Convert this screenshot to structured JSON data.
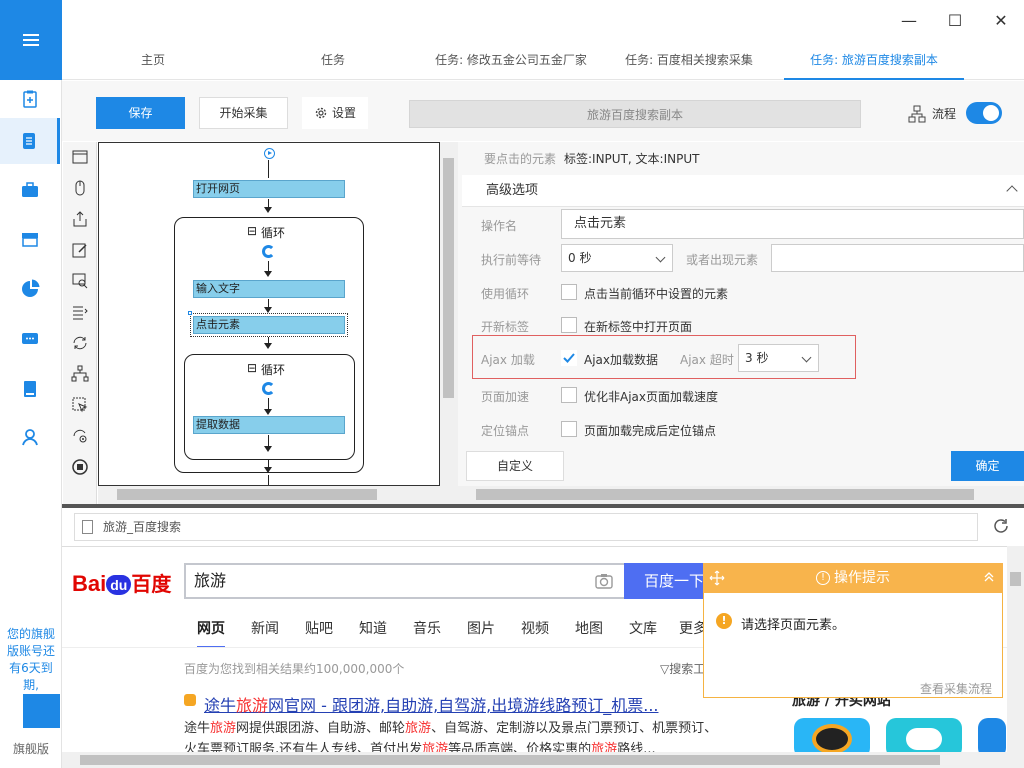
{
  "window": {
    "minimize": "—",
    "maximize": "☐",
    "close": "✕"
  },
  "tabs": [
    "主页",
    "任务",
    "任务: 修改五金公司五金厂家",
    "任务: 百度相关搜索采集",
    "任务: 旅游百度搜索副本"
  ],
  "toolbar": {
    "save": "保存",
    "start": "开始采集",
    "settings": "设置",
    "task_name": "旅游百度搜索副本",
    "flow": "流程",
    "flow_toggle": true
  },
  "sidebar": {
    "trial_notice": "您的旗舰版账号还有6天到期,",
    "edition": "旗舰版"
  },
  "workflow": {
    "open_page": "打开网页",
    "loop1": "循环",
    "input_text": "输入文字",
    "click_element": "点击元素",
    "loop2": "循环",
    "extract": "提取数据",
    "collapse": "⊟"
  },
  "panel": {
    "target_label": "要点击的元素",
    "target_value": "标签:INPUT, 文本:INPUT",
    "advanced": "高级选项",
    "op_name_label": "操作名",
    "op_name_value": "点击元素",
    "wait_label": "执行前等待",
    "wait_value": "0 秒",
    "or_appear_label": "或者出现元素",
    "use_loop_label": "使用循环",
    "use_loop_text": "点击当前循环中设置的元素",
    "new_tab_label": "开新标签",
    "new_tab_text": "在新标签中打开页面",
    "ajax_label": "Ajax 加载",
    "ajax_text": "Ajax加载数据",
    "ajax_timeout_label": "Ajax 超时",
    "ajax_timeout_value": "3 秒",
    "speed_label": "页面加速",
    "speed_text": "优化非Ajax页面加载速度",
    "anchor_label": "定位锚点",
    "anchor_text": "页面加载完成后定位锚点",
    "custom": "自定义",
    "ok": "确定"
  },
  "browser": {
    "url": "旅游_百度搜索",
    "logo_bai": "Bai",
    "logo_du": "du",
    "logo_text": "百度",
    "query": "旅游",
    "search_btn": "百度一下",
    "nav": [
      "网页",
      "新闻",
      "贴吧",
      "知道",
      "音乐",
      "图片",
      "视频",
      "地图",
      "文库",
      "更多"
    ],
    "result_count": "百度为您找到相关结果约100,000,000个",
    "tools": "▽搜索工",
    "result_title_a": "途牛",
    "result_title_b": "旅游",
    "result_title_c": "网官网 - 跟团游,自助游,自驾游,出境游线路预订_机票...",
    "desc1_a": "途牛",
    "desc1_b": "旅游",
    "desc1_c": "网提供跟团游、自助游、邮轮",
    "desc1_d": "旅游",
    "desc1_e": "、自驾游、定制游以及景点门票预订、机票预订、",
    "desc2_a": "火车票预订服务,还有牛人专线、首付出发",
    "desc2_b": "旅游",
    "desc2_c": "等品质高端、价格实惠的",
    "desc2_d": "旅游",
    "desc2_e": "路线...",
    "side_title": "旅游 / 开买网站"
  },
  "popup": {
    "title": "操作提示",
    "message": "请选择页面元素。",
    "link": "查看采集流程"
  },
  "colors": {
    "accent": "#1e88e5",
    "warning": "#f8b44c",
    "node": "#87ceeb"
  }
}
